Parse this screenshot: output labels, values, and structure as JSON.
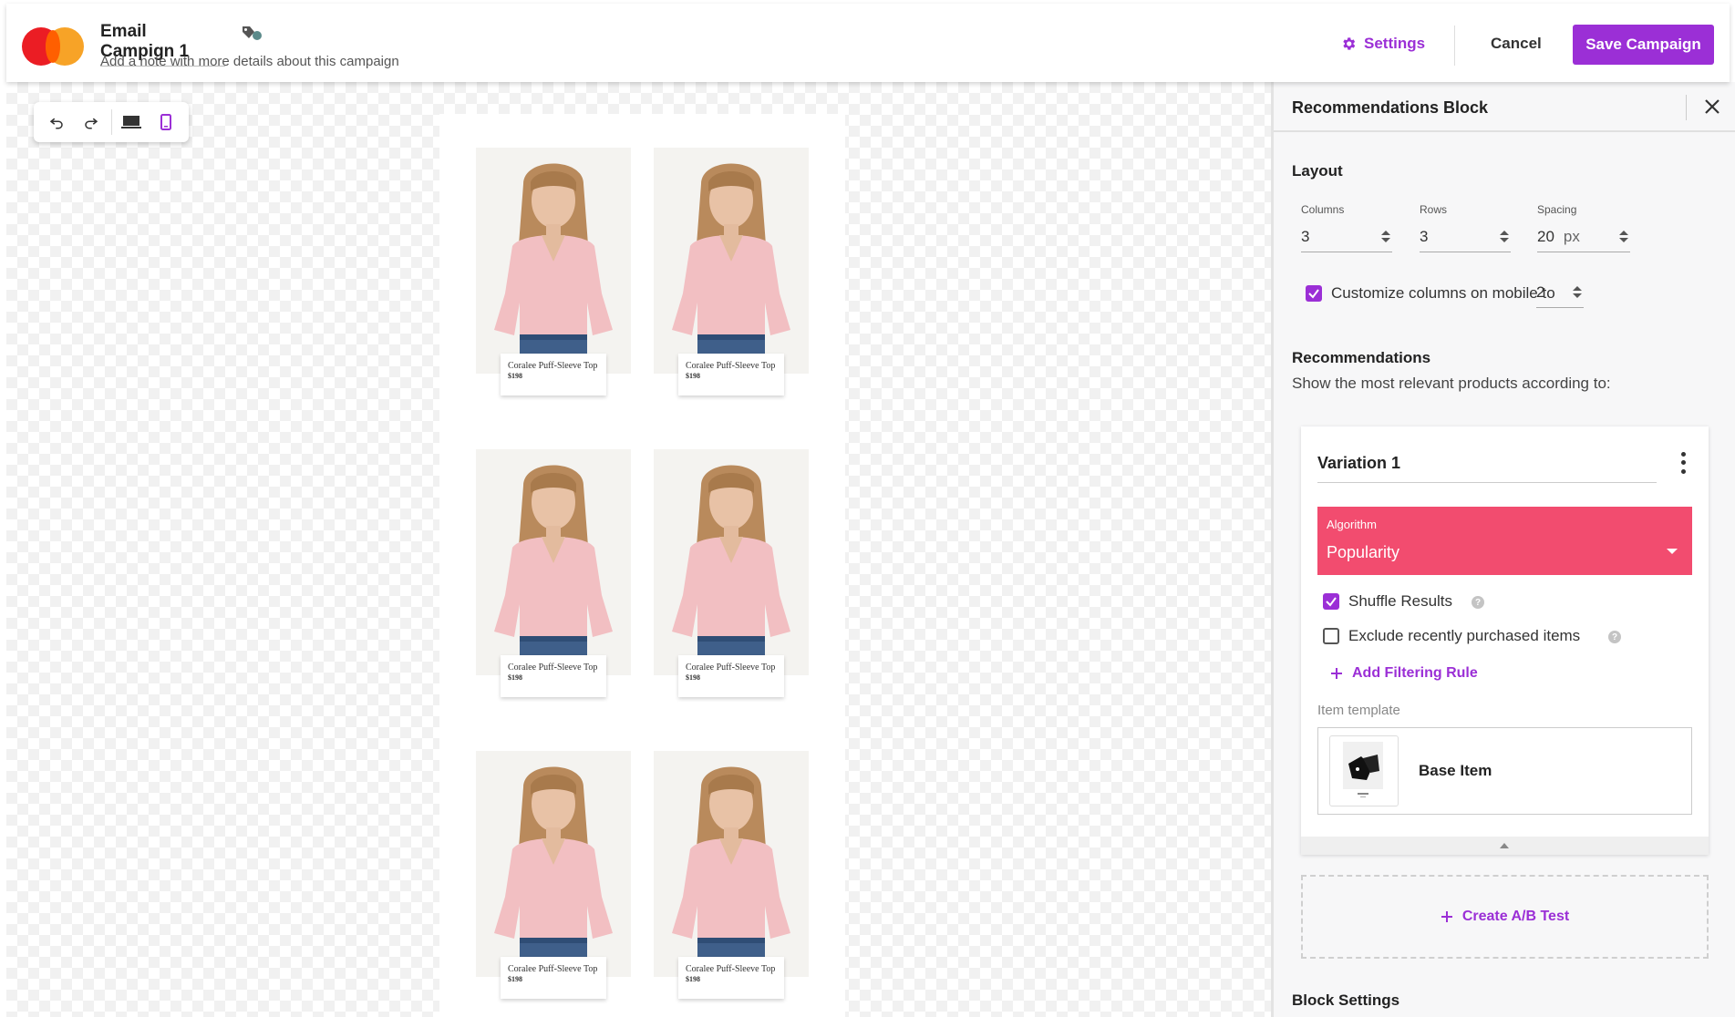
{
  "header": {
    "campaign_title": "Email Campign 1",
    "campaign_note": "Add a note with more details about this campaign",
    "settings_label": "Settings",
    "cancel_label": "Cancel",
    "save_label": "Save Campaign",
    "accent_color": "#9b2fd6"
  },
  "toolbar": {
    "items": [
      "undo-icon",
      "redo-icon",
      "desktop-icon",
      "mobile-icon"
    ],
    "active": "mobile-icon"
  },
  "products": [
    {
      "name": "Coralee Puff-Sleeve Top",
      "price": "$198"
    },
    {
      "name": "Coralee Puff-Sleeve Top",
      "price": "$198"
    },
    {
      "name": "Coralee Puff-Sleeve Top",
      "price": "$198"
    },
    {
      "name": "Coralee Puff-Sleeve Top",
      "price": "$198"
    },
    {
      "name": "Coralee Puff-Sleeve Top",
      "price": "$198"
    },
    {
      "name": "Coralee Puff-Sleeve Top",
      "price": "$198"
    }
  ],
  "panel": {
    "title": "Recommendations Block",
    "layout": {
      "title": "Layout",
      "columns_label": "Columns",
      "columns_value": "3",
      "rows_label": "Rows",
      "rows_value": "3",
      "spacing_label": "Spacing",
      "spacing_value": "20",
      "spacing_unit": "px",
      "mobile_label": "Customize columns on mobile to",
      "mobile_checked": true,
      "mobile_value": "2"
    },
    "recommendations": {
      "title": "Recommendations",
      "subtitle": "Show the most relevant products according to:",
      "variation": {
        "title": "Variation 1",
        "algorithm_label": "Algorithm",
        "algorithm_value": "Popularity",
        "algorithm_color": "#f24c6f",
        "shuffle_label": "Shuffle Results",
        "shuffle_checked": true,
        "exclude_label": "Exclude recently purchased items",
        "exclude_checked": false,
        "add_rule_label": "Add Filtering Rule",
        "template_label": "Item template",
        "template_name": "Base Item"
      },
      "ab_test_label": "Create A/B Test"
    },
    "block_settings_title": "Block Settings"
  }
}
